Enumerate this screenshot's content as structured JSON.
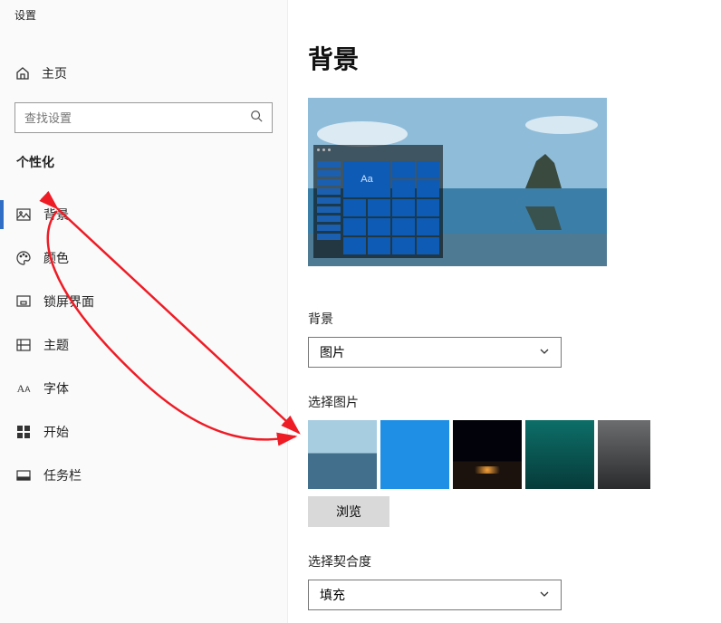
{
  "sidebar": {
    "title": "设置",
    "home": "主页",
    "search_placeholder": "查找设置",
    "category": "个性化",
    "items": [
      {
        "label": "背景",
        "selected": true
      },
      {
        "label": "颜色"
      },
      {
        "label": "锁屏界面"
      },
      {
        "label": "主题"
      },
      {
        "label": "字体"
      },
      {
        "label": "开始"
      },
      {
        "label": "任务栏"
      }
    ]
  },
  "page": {
    "title": "背景",
    "preview_tile_label": "Aa",
    "bg_type_label": "背景",
    "bg_type_value": "图片",
    "choose_image_label": "选择图片",
    "browse_label": "浏览",
    "fit_label": "选择契合度",
    "fit_value": "填充"
  }
}
